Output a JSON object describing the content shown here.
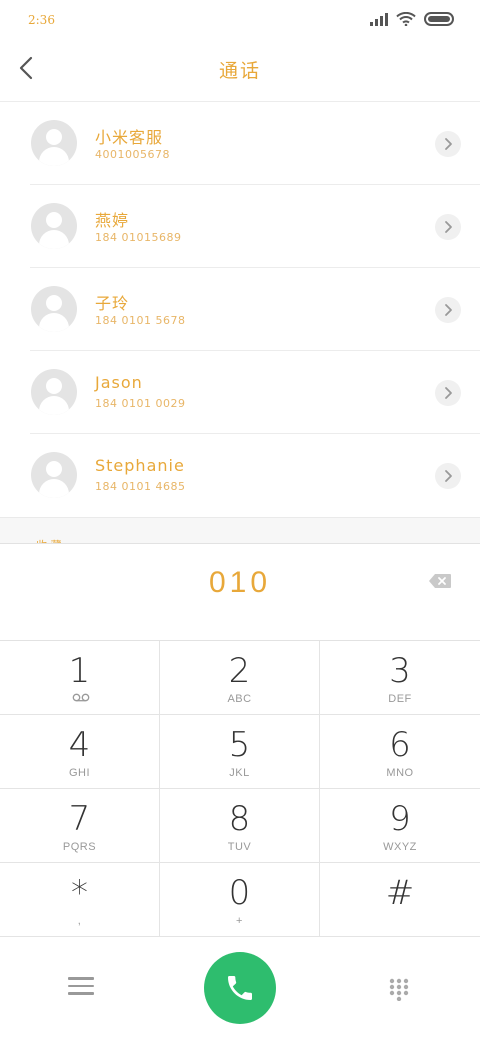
{
  "status": {
    "time": "2:36"
  },
  "header": {
    "title": "通话"
  },
  "contacts": [
    {
      "name": "小米客服",
      "number": "4001005678"
    },
    {
      "name": "燕婷",
      "number": "184 01015689"
    },
    {
      "name": "子玲",
      "number": "184 0101 5678"
    },
    {
      "name": "Jason",
      "number": "184 0101 0029"
    },
    {
      "name": "Stephanie",
      "number": "184 0101 4685"
    }
  ],
  "list_peek": {
    "text": "收 藏"
  },
  "dialer": {
    "input": "010"
  },
  "keypad": [
    {
      "digit": "1",
      "letters": ""
    },
    {
      "digit": "2",
      "letters": "ABC"
    },
    {
      "digit": "3",
      "letters": "DEF"
    },
    {
      "digit": "4",
      "letters": "GHI"
    },
    {
      "digit": "5",
      "letters": "JKL"
    },
    {
      "digit": "6",
      "letters": "MNO"
    },
    {
      "digit": "7",
      "letters": "PQRS"
    },
    {
      "digit": "8",
      "letters": "TUV"
    },
    {
      "digit": "9",
      "letters": "WXYZ"
    },
    {
      "digit": "*",
      "letters": ","
    },
    {
      "digit": "0",
      "letters": "+"
    },
    {
      "digit": "#",
      "letters": ""
    }
  ],
  "icons": {
    "back": "back-arrow-icon",
    "detail": "chevron-right-icon",
    "backspace": "backspace-icon",
    "voicemail": "voicemail-icon",
    "menu": "menu-icon",
    "call": "phone-icon",
    "dialpad": "dialpad-icon"
  },
  "colors": {
    "accent": "#e8a83a",
    "call_green": "#2ebd6e"
  }
}
